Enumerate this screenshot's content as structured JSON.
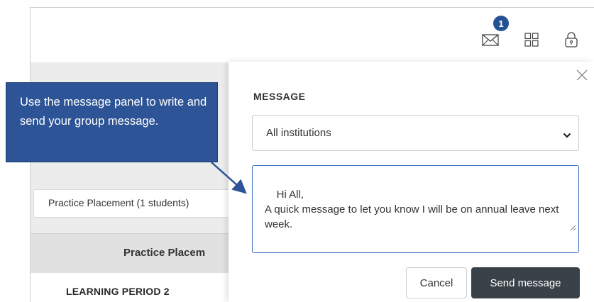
{
  "header": {
    "mail_badge": "1",
    "icons": [
      "mail-icon",
      "grid-icon",
      "lock-icon"
    ]
  },
  "background": {
    "placement_select": "Practice Placement (1 students)",
    "table_header": "Practice Placem",
    "learning_period": "LEARNING PERIOD 2"
  },
  "callout": {
    "text": "Use the message panel to write and send your group message."
  },
  "message_panel": {
    "title": "MESSAGE",
    "recipient_select": "All institutions",
    "message_body": "Hi All,\nA quick message to let you know I will be on annual leave next week.",
    "cancel_label": "Cancel",
    "send_label": "Send message"
  },
  "colors": {
    "accent": "#245394",
    "callout_bg": "#2d5496",
    "send_button": "#3a4249",
    "focus_border": "#3a6fbf"
  }
}
